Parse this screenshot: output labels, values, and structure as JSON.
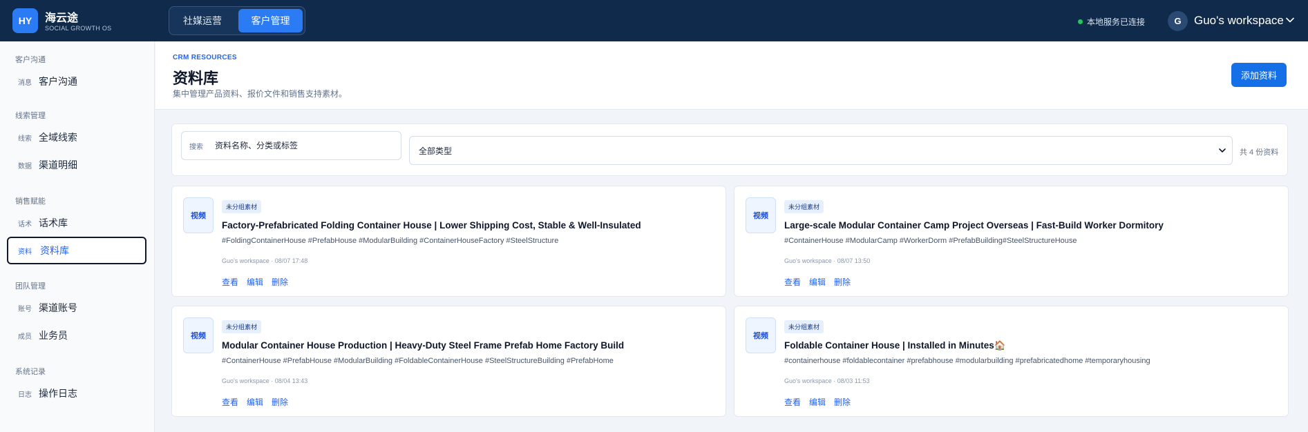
{
  "topbar": {
    "logo_text": "HY",
    "brand_name": "海云途",
    "brand_sub": "SOCIAL GROWTH OS",
    "modes": [
      "社媒运营",
      "客户管理"
    ],
    "active_mode": "客户管理",
    "status_text": "本地服务已连接",
    "workspace_initial": "G",
    "workspace_name": "Guo's workspace",
    "accent": "#2b7bf4",
    "bg": "#0f2a4a",
    "status_color": "#22c55e"
  },
  "sidebar": {
    "sections": [
      {
        "title": "客户沟通",
        "items": [
          {
            "tag": "消息",
            "label": "客户沟通"
          }
        ]
      },
      {
        "title": "线索管理",
        "items": [
          {
            "tag": "线索",
            "label": "全域线索"
          },
          {
            "tag": "数据",
            "label": "渠道明细"
          }
        ]
      },
      {
        "title": "销售赋能",
        "items": [
          {
            "tag": "话术",
            "label": "话术库"
          },
          {
            "tag": "资料",
            "label": "资料库"
          }
        ]
      },
      {
        "title": "团队管理",
        "items": [
          {
            "tag": "账号",
            "label": "渠道账号"
          },
          {
            "tag": "成员",
            "label": "业务员"
          }
        ]
      },
      {
        "title": "系统记录",
        "items": [
          {
            "tag": "日志",
            "label": "操作日志"
          }
        ]
      }
    ],
    "active_item": "资料库"
  },
  "header": {
    "eyebrow": "CRM RESOURCES",
    "title": "资料库",
    "subtitle": "集中管理产品资料、报价文件和销售支持素材。",
    "add_button": "添加资料"
  },
  "filters": {
    "search_label": "搜索",
    "search_placeholder": "资料名称、分类或标签",
    "type_selected": "全部类型",
    "count_text": "共 4 份资料"
  },
  "cards": [
    {
      "badge": "视频",
      "group": "未分组素材",
      "title": "Factory-Prefabricated Folding Container House | Lower Shipping Cost, Stable & Well-Insulated",
      "tags": "#FoldingContainerHouse #PrefabHouse #ModularBuilding #ContainerHouseFactory #SteelStructure",
      "meta": "Guo's workspace · 08/07 17:48",
      "actions": [
        "查看",
        "编辑",
        "删除"
      ]
    },
    {
      "badge": "视频",
      "group": "未分组素材",
      "title": "Large-scale Modular Container Camp Project Overseas | Fast-Build Worker Dormitory",
      "tags": "#ContainerHouse #ModularCamp #WorkerDorm #PrefabBuilding#SteelStructureHouse",
      "meta": "Guo's workspace · 08/07 13:50",
      "actions": [
        "查看",
        "编辑",
        "删除"
      ]
    },
    {
      "badge": "视频",
      "group": "未分组素材",
      "title": "Modular Container House Production | Heavy-Duty Steel Frame Prefab Home Factory Build",
      "tags": "#ContainerHouse #PrefabHouse #ModularBuilding #FoldableContainerHouse #SteelStructureBuilding #PrefabHome",
      "meta": "Guo's workspace · 08/04 13:43",
      "actions": [
        "查看",
        "编辑",
        "删除"
      ]
    },
    {
      "badge": "视频",
      "group": "未分组素材",
      "title": "Foldable Container House | Installed in Minutes🏠",
      "tags": "#containerhouse #foldablecontainer #prefabhouse #modularbuilding #prefabricatedhome #temporaryhousing",
      "meta": "Guo's workspace · 08/03 11:53",
      "actions": [
        "查看",
        "编辑",
        "删除"
      ]
    }
  ]
}
